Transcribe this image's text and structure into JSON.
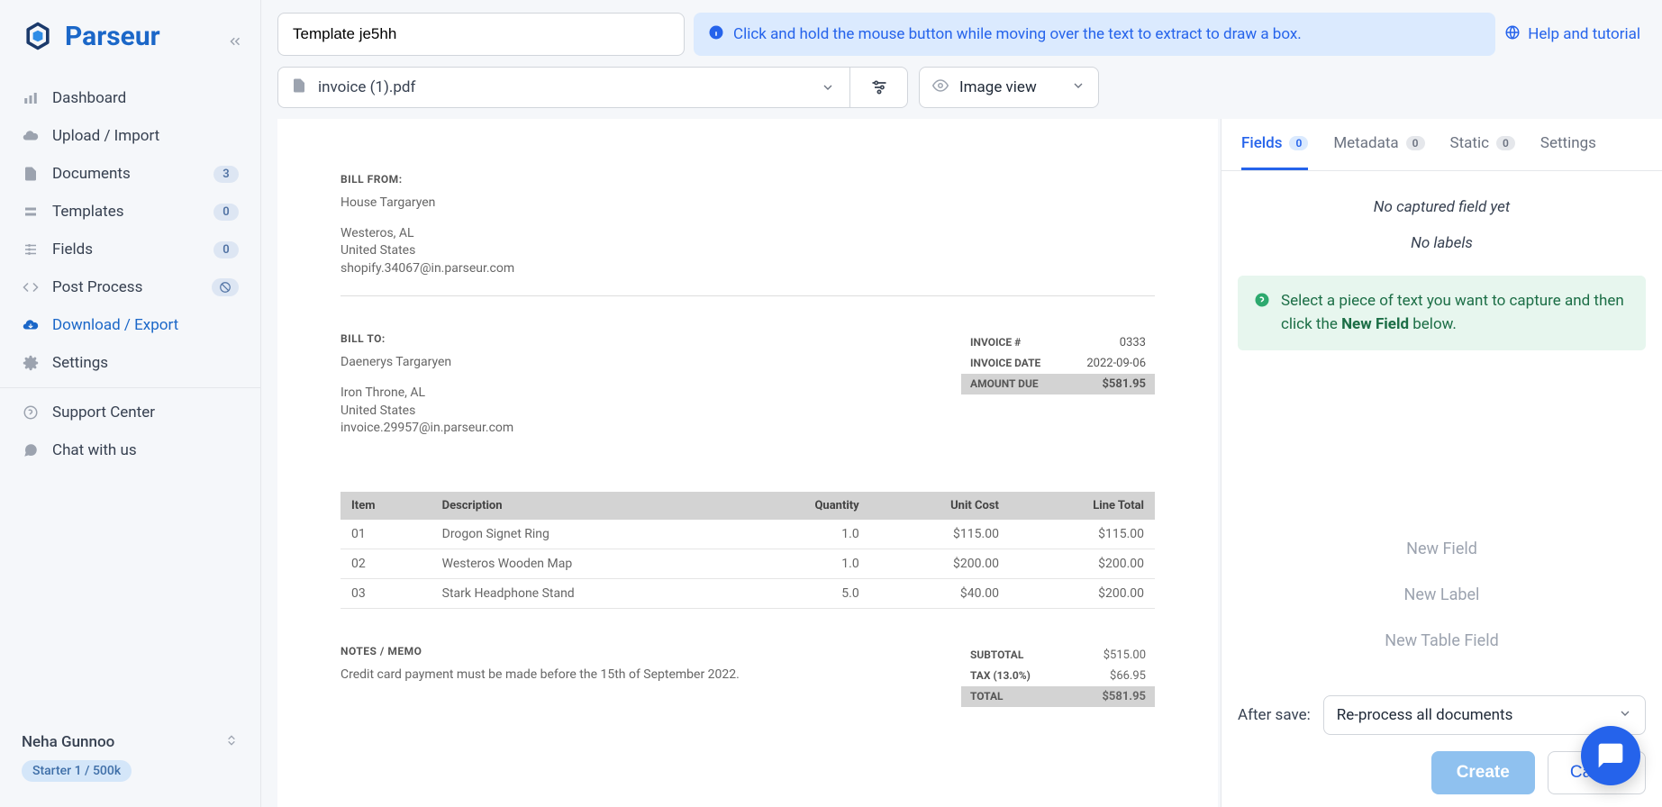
{
  "brand": "Parseur",
  "sidebar": {
    "items": [
      {
        "label": "Dashboard",
        "badge": null
      },
      {
        "label": "Upload / Import",
        "badge": null
      },
      {
        "label": "Documents",
        "badge": "3"
      },
      {
        "label": "Templates",
        "badge": "0"
      },
      {
        "label": "Fields",
        "badge": "0"
      },
      {
        "label": "Post Process",
        "badge": null
      },
      {
        "label": "Download / Export",
        "badge": null
      },
      {
        "label": "Settings",
        "badge": null
      }
    ],
    "support": "Support Center",
    "chat": "Chat with us",
    "user": "Neha Gunnoo",
    "plan": "Starter 1 / 500k"
  },
  "header": {
    "template_name": "Template je5hh",
    "info": "Click and hold the mouse button while moving over the text to extract to draw a box.",
    "help": "Help and tutorial",
    "file_name": "invoice (1).pdf",
    "view_mode": "Image view"
  },
  "panel": {
    "tabs": [
      {
        "label": "Fields",
        "count": "0"
      },
      {
        "label": "Metadata",
        "count": "0"
      },
      {
        "label": "Static",
        "count": "0"
      },
      {
        "label": "Settings",
        "count": null
      }
    ],
    "empty1": "No captured field yet",
    "empty2": "No labels",
    "hint_prefix": "Select a piece of text you want to capture and then click the ",
    "hint_bold": "New Field",
    "hint_suffix": " below.",
    "new_field": "New Field",
    "new_label": "New Label",
    "new_table": "New Table Field",
    "after_save_label": "After save:",
    "after_save_value": "Re-process all documents",
    "create": "Create",
    "cancel": "Cancel"
  },
  "doc": {
    "bill_from_title": "BILL FROM:",
    "bill_from": {
      "name": "House Targaryen",
      "addr": "Westeros, AL",
      "country": "United States",
      "email": "shopify.34067@in.parseur.com"
    },
    "bill_to_title": "BILL TO:",
    "bill_to": {
      "name": "Daenerys Targaryen",
      "addr": "Iron Throne, AL",
      "country": "United States",
      "email": "invoice.29957@in.parseur.com"
    },
    "meta": {
      "num_k": "INVOICE #",
      "num_v": "0333",
      "date_k": "INVOICE DATE",
      "date_v": "2022-09-06",
      "due_k": "AMOUNT DUE",
      "due_v": "$581.95"
    },
    "cols": {
      "item": "Item",
      "desc": "Description",
      "qty": "Quantity",
      "unit": "Unit Cost",
      "total": "Line Total"
    },
    "items": [
      {
        "no": "01",
        "desc": "Drogon Signet Ring",
        "qty": "1.0",
        "unit": "$115.00",
        "total": "$115.00"
      },
      {
        "no": "02",
        "desc": "Westeros Wooden Map",
        "qty": "1.0",
        "unit": "$200.00",
        "total": "$200.00"
      },
      {
        "no": "03",
        "desc": "Stark Headphone Stand",
        "qty": "5.0",
        "unit": "$40.00",
        "total": "$200.00"
      }
    ],
    "notes_title": "NOTES / MEMO",
    "notes": "Credit card payment must be made before the 15th of September 2022.",
    "totals": {
      "sub_k": "SUBTOTAL",
      "sub_v": "$515.00",
      "tax_k": "TAX (13.0%)",
      "tax_v": "$66.95",
      "tot_k": "TOTAL",
      "tot_v": "$581.95"
    }
  }
}
